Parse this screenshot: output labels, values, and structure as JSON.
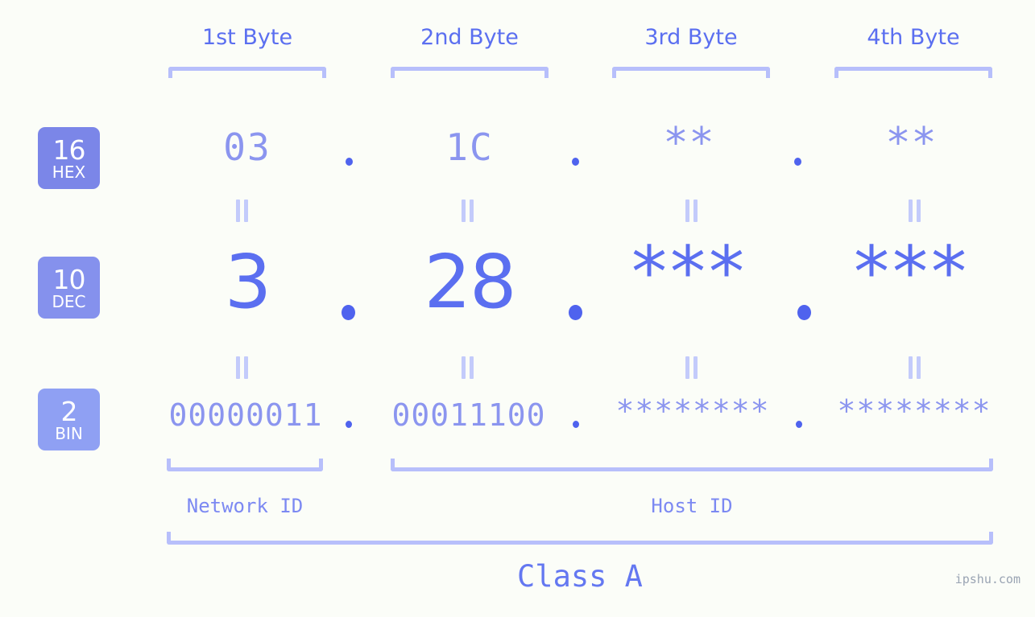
{
  "background_color": "#fbfdf8",
  "accent_color": "#5b6ff0",
  "accent_light": "#8b95ef",
  "bracket_color": "#b7bffb",
  "header": {
    "bytes": [
      {
        "label": "1st Byte"
      },
      {
        "label": "2nd Byte"
      },
      {
        "label": "3rd Byte"
      },
      {
        "label": "4th Byte"
      }
    ]
  },
  "rows": [
    {
      "badge_number": "16",
      "badge_system": "HEX",
      "badge_color": "#7b86e8",
      "values": [
        "03",
        "1C",
        "**",
        "**"
      ],
      "separator": "."
    },
    {
      "badge_number": "10",
      "badge_system": "DEC",
      "badge_color": "#8591ed",
      "values": [
        "3",
        "28",
        "***",
        "***"
      ],
      "separator": "."
    },
    {
      "badge_number": "2",
      "badge_system": "BIN",
      "badge_color": "#8fa0f3",
      "values": [
        "00000011",
        "00011100",
        "********",
        "********"
      ],
      "separator": "."
    }
  ],
  "equality_marks": {
    "glyph": "||",
    "count_per_gap": 4
  },
  "footer": {
    "network_id_label": "Network ID",
    "host_id_label": "Host ID",
    "class_label": "Class A",
    "watermark": "ipshu.com"
  }
}
